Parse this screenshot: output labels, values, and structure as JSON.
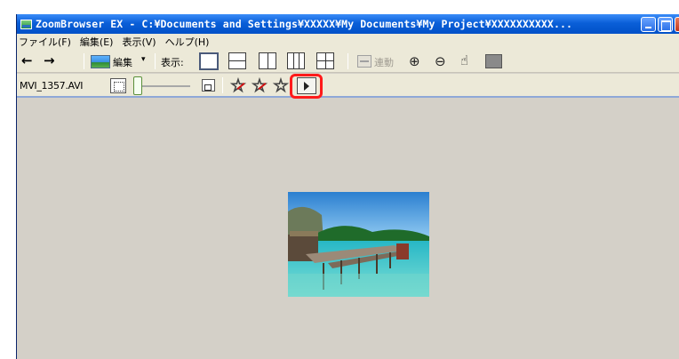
{
  "window": {
    "title": "ZoomBrowser EX - C:¥Documents and Settings¥XXXXX¥My Documents¥My Project¥XXXXXXXXXX..."
  },
  "menu": {
    "items": [
      {
        "label": "ファイル(F)"
      },
      {
        "label": "編集(E)"
      },
      {
        "label": "表示(V)"
      },
      {
        "label": "ヘルプ(H)"
      }
    ]
  },
  "toolbar": {
    "back_icon": "←",
    "forward_icon": "→",
    "edit_label": "編集",
    "edit_dropdown_icon": "▾",
    "view_label": "表示:",
    "sync_label": "連動",
    "zoom_in_icon": "⊕",
    "zoom_out_icon": "⊖",
    "hand_icon": "☝"
  },
  "viewer_toolbar": {
    "filename": "MVI_1357.AVI",
    "star_icon": "☆"
  },
  "colors": {
    "title_bar": "#0a5fd8",
    "highlight": "#ff1a1a",
    "background": "#d4d0c8"
  }
}
